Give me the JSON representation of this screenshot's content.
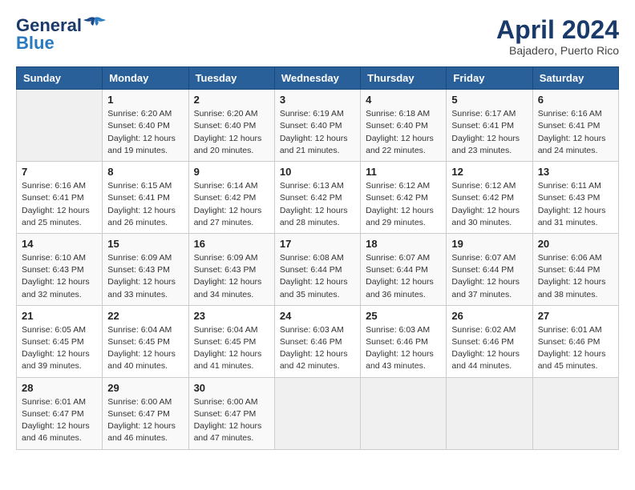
{
  "header": {
    "logo_line1": "General",
    "logo_line2": "Blue",
    "title": "April 2024",
    "subtitle": "Bajadero, Puerto Rico"
  },
  "days_of_week": [
    "Sunday",
    "Monday",
    "Tuesday",
    "Wednesday",
    "Thursday",
    "Friday",
    "Saturday"
  ],
  "weeks": [
    [
      {
        "day": "",
        "info": ""
      },
      {
        "day": "1",
        "info": "Sunrise: 6:20 AM\nSunset: 6:40 PM\nDaylight: 12 hours\nand 19 minutes."
      },
      {
        "day": "2",
        "info": "Sunrise: 6:20 AM\nSunset: 6:40 PM\nDaylight: 12 hours\nand 20 minutes."
      },
      {
        "day": "3",
        "info": "Sunrise: 6:19 AM\nSunset: 6:40 PM\nDaylight: 12 hours\nand 21 minutes."
      },
      {
        "day": "4",
        "info": "Sunrise: 6:18 AM\nSunset: 6:40 PM\nDaylight: 12 hours\nand 22 minutes."
      },
      {
        "day": "5",
        "info": "Sunrise: 6:17 AM\nSunset: 6:41 PM\nDaylight: 12 hours\nand 23 minutes."
      },
      {
        "day": "6",
        "info": "Sunrise: 6:16 AM\nSunset: 6:41 PM\nDaylight: 12 hours\nand 24 minutes."
      }
    ],
    [
      {
        "day": "7",
        "info": "Sunrise: 6:16 AM\nSunset: 6:41 PM\nDaylight: 12 hours\nand 25 minutes."
      },
      {
        "day": "8",
        "info": "Sunrise: 6:15 AM\nSunset: 6:41 PM\nDaylight: 12 hours\nand 26 minutes."
      },
      {
        "day": "9",
        "info": "Sunrise: 6:14 AM\nSunset: 6:42 PM\nDaylight: 12 hours\nand 27 minutes."
      },
      {
        "day": "10",
        "info": "Sunrise: 6:13 AM\nSunset: 6:42 PM\nDaylight: 12 hours\nand 28 minutes."
      },
      {
        "day": "11",
        "info": "Sunrise: 6:12 AM\nSunset: 6:42 PM\nDaylight: 12 hours\nand 29 minutes."
      },
      {
        "day": "12",
        "info": "Sunrise: 6:12 AM\nSunset: 6:42 PM\nDaylight: 12 hours\nand 30 minutes."
      },
      {
        "day": "13",
        "info": "Sunrise: 6:11 AM\nSunset: 6:43 PM\nDaylight: 12 hours\nand 31 minutes."
      }
    ],
    [
      {
        "day": "14",
        "info": "Sunrise: 6:10 AM\nSunset: 6:43 PM\nDaylight: 12 hours\nand 32 minutes."
      },
      {
        "day": "15",
        "info": "Sunrise: 6:09 AM\nSunset: 6:43 PM\nDaylight: 12 hours\nand 33 minutes."
      },
      {
        "day": "16",
        "info": "Sunrise: 6:09 AM\nSunset: 6:43 PM\nDaylight: 12 hours\nand 34 minutes."
      },
      {
        "day": "17",
        "info": "Sunrise: 6:08 AM\nSunset: 6:44 PM\nDaylight: 12 hours\nand 35 minutes."
      },
      {
        "day": "18",
        "info": "Sunrise: 6:07 AM\nSunset: 6:44 PM\nDaylight: 12 hours\nand 36 minutes."
      },
      {
        "day": "19",
        "info": "Sunrise: 6:07 AM\nSunset: 6:44 PM\nDaylight: 12 hours\nand 37 minutes."
      },
      {
        "day": "20",
        "info": "Sunrise: 6:06 AM\nSunset: 6:44 PM\nDaylight: 12 hours\nand 38 minutes."
      }
    ],
    [
      {
        "day": "21",
        "info": "Sunrise: 6:05 AM\nSunset: 6:45 PM\nDaylight: 12 hours\nand 39 minutes."
      },
      {
        "day": "22",
        "info": "Sunrise: 6:04 AM\nSunset: 6:45 PM\nDaylight: 12 hours\nand 40 minutes."
      },
      {
        "day": "23",
        "info": "Sunrise: 6:04 AM\nSunset: 6:45 PM\nDaylight: 12 hours\nand 41 minutes."
      },
      {
        "day": "24",
        "info": "Sunrise: 6:03 AM\nSunset: 6:46 PM\nDaylight: 12 hours\nand 42 minutes."
      },
      {
        "day": "25",
        "info": "Sunrise: 6:03 AM\nSunset: 6:46 PM\nDaylight: 12 hours\nand 43 minutes."
      },
      {
        "day": "26",
        "info": "Sunrise: 6:02 AM\nSunset: 6:46 PM\nDaylight: 12 hours\nand 44 minutes."
      },
      {
        "day": "27",
        "info": "Sunrise: 6:01 AM\nSunset: 6:46 PM\nDaylight: 12 hours\nand 45 minutes."
      }
    ],
    [
      {
        "day": "28",
        "info": "Sunrise: 6:01 AM\nSunset: 6:47 PM\nDaylight: 12 hours\nand 46 minutes."
      },
      {
        "day": "29",
        "info": "Sunrise: 6:00 AM\nSunset: 6:47 PM\nDaylight: 12 hours\nand 46 minutes."
      },
      {
        "day": "30",
        "info": "Sunrise: 6:00 AM\nSunset: 6:47 PM\nDaylight: 12 hours\nand 47 minutes."
      },
      {
        "day": "",
        "info": ""
      },
      {
        "day": "",
        "info": ""
      },
      {
        "day": "",
        "info": ""
      },
      {
        "day": "",
        "info": ""
      }
    ]
  ]
}
